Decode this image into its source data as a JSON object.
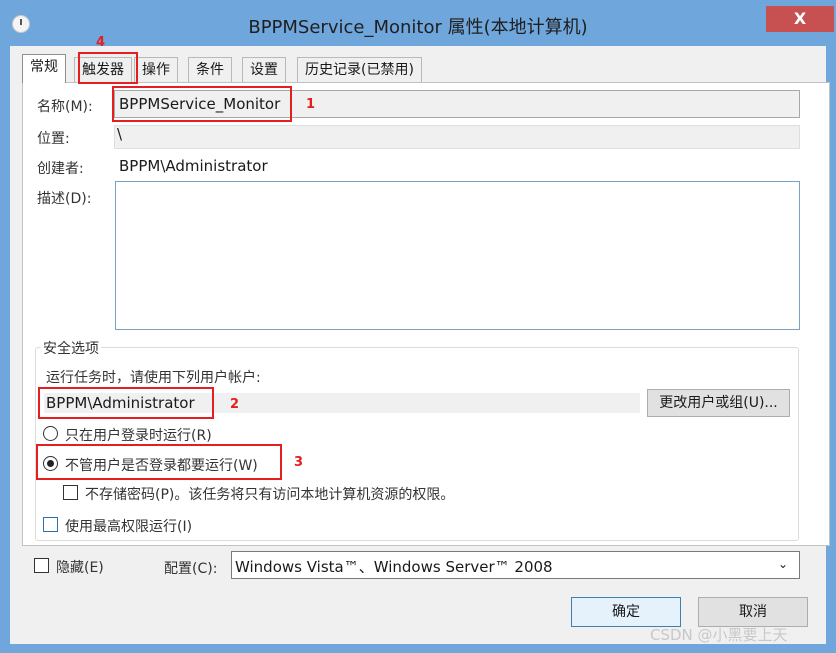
{
  "window": {
    "title": "BPPMService_Monitor 属性(本地计算机)",
    "close_label": "X"
  },
  "tabs": [
    {
      "label": "常规",
      "active": true
    },
    {
      "label": "触发器"
    },
    {
      "label": "操作"
    },
    {
      "label": "条件"
    },
    {
      "label": "设置"
    },
    {
      "label": "历史记录(已禁用)"
    }
  ],
  "general": {
    "name_label": "名称(M):",
    "name_value": "BPPMService_Monitor",
    "location_label": "位置:",
    "location_value": "\\",
    "author_label": "创建者:",
    "author_value": "BPPM\\Administrator",
    "description_label": "描述(D):",
    "description_value": ""
  },
  "security": {
    "group_title": "安全选项",
    "run_as_prompt": "运行任务时，请使用下列用户帐户:",
    "user_account": "BPPM\\Administrator",
    "change_button": "更改用户或组(U)...",
    "radio_logged_on": "只在用户登录时运行(R)",
    "radio_whether": "不管用户是否登录都要运行(W)",
    "no_store_password": "不存储密码(P)。该任务将只有访问本地计算机资源的权限。",
    "highest_privileges": "使用最高权限运行(I)"
  },
  "footer": {
    "hidden_label": "隐藏(E)",
    "configure_label": "配置(C):",
    "configure_value": "Windows Vista™、Windows Server™ 2008",
    "ok_button": "确定",
    "cancel_button": "取消"
  },
  "annotations": {
    "n1": "1",
    "n2": "2",
    "n3": "3",
    "n4": "4"
  },
  "watermark": "CSDN @小黑要上天",
  "colors": {
    "title_bar": "#6fa6dc",
    "close_button": "#c75050",
    "annotation_red": "#e31f1f"
  }
}
